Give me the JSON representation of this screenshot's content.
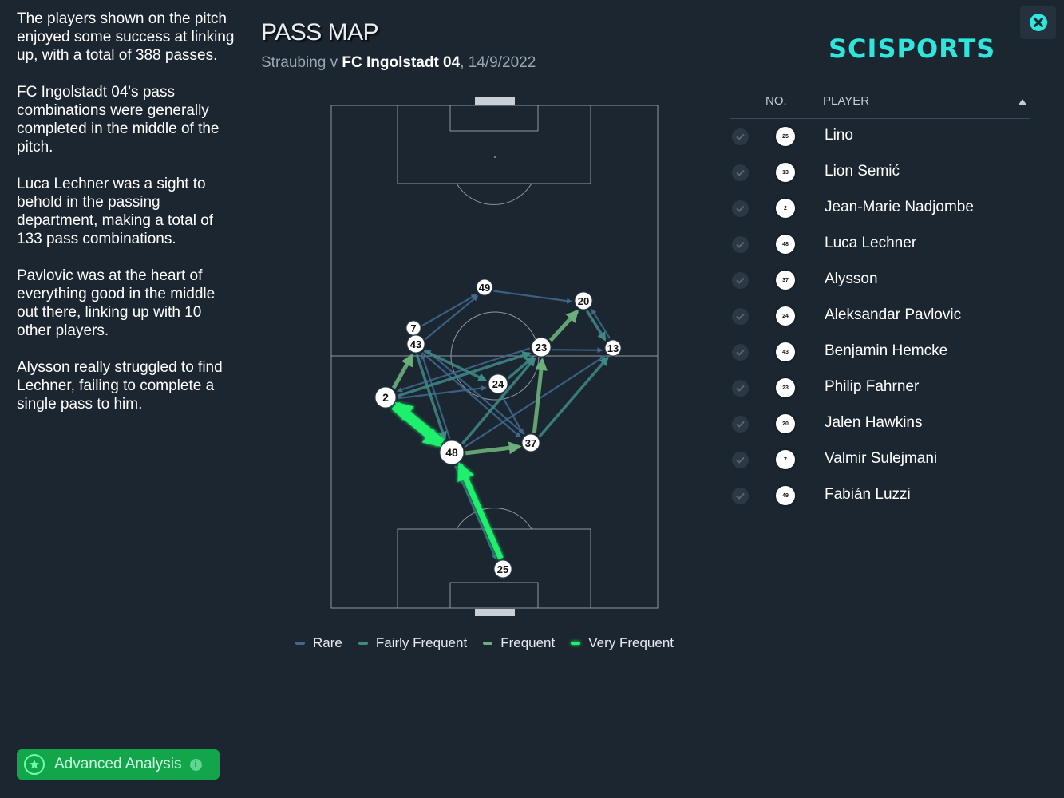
{
  "summary": [
    "The players shown on the pitch enjoyed some success at linking up, with a total of 388 passes.",
    "FC Ingolstadt 04's pass combinations were generally completed in the middle of the pitch.",
    "Luca Lechner was a sight to behold in the passing department, making a total of 133 pass combinations.",
    "Pavlovic was at the heart of everything good in the middle out there, linking up with 10 other players.",
    "Alysson really struggled to find Lechner, failing to complete a single pass to him."
  ],
  "header": {
    "title": "PASS MAP",
    "home_team": "Straubing",
    "vs": "v",
    "away_team": "FC Ingolstadt 04",
    "date": "14/9/2022"
  },
  "brand": {
    "logo_text": "SCISPORTS",
    "color": "#2ee6dc"
  },
  "icons": {
    "close": "close-icon",
    "check": "check-icon",
    "sort": "sort-asc-icon",
    "advanced": "star-badge-icon",
    "info": "info-icon"
  },
  "colors": {
    "background": "#1b2631",
    "pitch_line": "#8d98a3",
    "rare": "#3f6a8e",
    "fairly_frequent": "#3f8a86",
    "frequent": "#6bb07b",
    "very_frequent": "#1ef06d"
  },
  "legend": [
    {
      "label": "Rare",
      "color": "#3f6a8e"
    },
    {
      "label": "Fairly Frequent",
      "color": "#3f8a86"
    },
    {
      "label": "Frequent",
      "color": "#6bb07b"
    },
    {
      "label": "Very Frequent",
      "color": "#1ef06d"
    }
  ],
  "roster": {
    "col_no": "NO.",
    "col_player": "PLAYER",
    "players": [
      {
        "no": "25",
        "name": "Lino"
      },
      {
        "no": "13",
        "name": "Lion Semić"
      },
      {
        "no": "2",
        "name": "Jean-Marie Nadjombe"
      },
      {
        "no": "48",
        "name": "Luca Lechner"
      },
      {
        "no": "37",
        "name": "Alysson"
      },
      {
        "no": "24",
        "name": "Aleksandar Pavlovic"
      },
      {
        "no": "43",
        "name": "Benjamin Hemcke"
      },
      {
        "no": "23",
        "name": "Philip Fahrner"
      },
      {
        "no": "20",
        "name": "Jalen Hawkins"
      },
      {
        "no": "7",
        "name": "Valmir Sulejmani"
      },
      {
        "no": "49",
        "name": "Fabián Luzzi"
      }
    ]
  },
  "pass_map": {
    "nodes": [
      {
        "no": "49"
      },
      {
        "no": "20"
      },
      {
        "no": "7"
      },
      {
        "no": "43"
      },
      {
        "no": "23"
      },
      {
        "no": "13"
      },
      {
        "no": "24"
      },
      {
        "no": "2"
      },
      {
        "no": "37"
      },
      {
        "no": "48"
      },
      {
        "no": "25"
      }
    ],
    "links": [
      {
        "from": "25",
        "to": "48",
        "level": "very_frequent"
      },
      {
        "from": "48",
        "to": "2",
        "level": "very_frequent"
      },
      {
        "from": "2",
        "to": "48",
        "level": "very_frequent"
      },
      {
        "from": "48",
        "to": "37",
        "level": "frequent"
      },
      {
        "from": "37",
        "to": "23",
        "level": "frequent"
      },
      {
        "from": "23",
        "to": "20",
        "level": "frequent"
      },
      {
        "from": "2",
        "to": "43",
        "level": "frequent"
      },
      {
        "from": "20",
        "to": "13",
        "level": "fairly_frequent"
      },
      {
        "from": "43",
        "to": "24",
        "level": "fairly_frequent"
      },
      {
        "from": "24",
        "to": "23",
        "level": "fairly_frequent"
      },
      {
        "from": "48",
        "to": "23",
        "level": "fairly_frequent"
      },
      {
        "from": "43",
        "to": "48",
        "level": "fairly_frequent"
      },
      {
        "from": "37",
        "to": "13",
        "level": "fairly_frequent"
      },
      {
        "from": "2",
        "to": "23",
        "level": "fairly_frequent"
      },
      {
        "from": "43",
        "to": "49",
        "level": "rare"
      },
      {
        "from": "49",
        "to": "20",
        "level": "rare"
      },
      {
        "from": "7",
        "to": "49",
        "level": "rare"
      },
      {
        "from": "48",
        "to": "25",
        "level": "rare"
      },
      {
        "from": "2",
        "to": "24",
        "level": "rare"
      },
      {
        "from": "24",
        "to": "37",
        "level": "rare"
      },
      {
        "from": "23",
        "to": "13",
        "level": "rare"
      },
      {
        "from": "13",
        "to": "20",
        "level": "rare"
      },
      {
        "from": "48",
        "to": "43",
        "level": "rare"
      },
      {
        "from": "23",
        "to": "2",
        "level": "rare"
      },
      {
        "from": "37",
        "to": "43",
        "level": "rare"
      },
      {
        "from": "48",
        "to": "13",
        "level": "rare"
      },
      {
        "from": "43",
        "to": "37",
        "level": "rare"
      }
    ]
  },
  "advanced": {
    "label": "Advanced Analysis",
    "info": "i"
  }
}
